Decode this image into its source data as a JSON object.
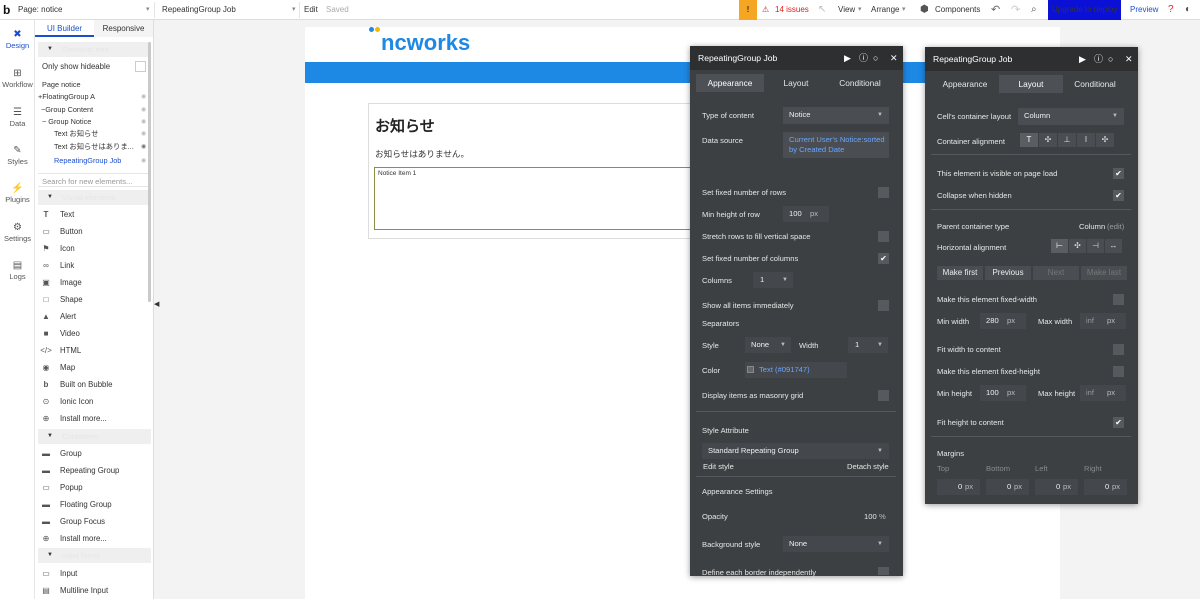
{
  "topbar": {
    "logo": "b",
    "page_label": "Page: notice",
    "element_selector": "RepeatingGroup Job",
    "edit": "Edit",
    "saved": "Saved",
    "issues": "14 issues",
    "view": "View",
    "arrange": "Arrange",
    "components": "Components",
    "deploy": "Upgrade to deploy",
    "preview": "Preview"
  },
  "rail": {
    "items": [
      {
        "label": "Design",
        "icon": "design-icon"
      },
      {
        "label": "Workflow",
        "icon": "workflow-icon"
      },
      {
        "label": "Data",
        "icon": "data-icon"
      },
      {
        "label": "Styles",
        "icon": "styles-icon"
      },
      {
        "label": "Plugins",
        "icon": "plugins-icon"
      },
      {
        "label": "Settings",
        "icon": "settings-icon"
      },
      {
        "label": "Logs",
        "icon": "logs-icon"
      }
    ]
  },
  "panel": {
    "tab_ui": "UI Builder",
    "tab_responsive": "Responsive",
    "elements_tree": "Elements tree",
    "only_hideable": "Only show hideable",
    "tree": [
      {
        "label": "Page notice"
      },
      {
        "label": "+FloatingGroup A"
      },
      {
        "label": "−Group Content"
      },
      {
        "label": "− Group Notice"
      },
      {
        "label": "Text お知らせ"
      },
      {
        "label": "Text お知らせはありま..."
      },
      {
        "label": "RepeatingGroup Job"
      }
    ],
    "search_placeholder": "Search for new elements...",
    "visual_elements": "Visual elements",
    "visual": [
      {
        "label": "Text",
        "icon": "text-icon"
      },
      {
        "label": "Button",
        "icon": "button-icon"
      },
      {
        "label": "Icon",
        "icon": "flag-icon"
      },
      {
        "label": "Link",
        "icon": "link-icon"
      },
      {
        "label": "Image",
        "icon": "image-icon"
      },
      {
        "label": "Shape",
        "icon": "shape-icon"
      },
      {
        "label": "Alert",
        "icon": "bell-icon"
      },
      {
        "label": "Video",
        "icon": "video-icon"
      },
      {
        "label": "HTML",
        "icon": "code-icon"
      },
      {
        "label": "Map",
        "icon": "map-pin-icon"
      },
      {
        "label": "Built on Bubble",
        "icon": "bubble-icon"
      },
      {
        "label": "Ionic Icon",
        "icon": "ionic-icon"
      },
      {
        "label": "Install more...",
        "icon": "plus-circle-icon"
      }
    ],
    "containers": "Containers",
    "container_items": [
      {
        "label": "Group",
        "icon": "folder-icon"
      },
      {
        "label": "Repeating Group",
        "icon": "folder-icon"
      },
      {
        "label": "Popup",
        "icon": "popup-icon"
      },
      {
        "label": "Floating Group",
        "icon": "folder-icon"
      },
      {
        "label": "Group Focus",
        "icon": "folder-icon"
      },
      {
        "label": "Install more...",
        "icon": "plus-circle-icon"
      }
    ],
    "input_forms": "Input forms",
    "input_items": [
      {
        "label": "Input",
        "icon": "input-icon"
      },
      {
        "label": "Multiline Input",
        "icon": "multiline-icon"
      }
    ]
  },
  "canvas": {
    "logo": "ncworks",
    "heading": "お知らせ",
    "message": "お知らせはありません。",
    "cell_label": "Notice Item 1"
  },
  "appearance": {
    "title": "RepeatingGroup Job",
    "tabs": [
      "Appearance",
      "Layout",
      "Conditional"
    ],
    "type_of_content_label": "Type of content",
    "type_of_content": "Notice",
    "data_source_label": "Data source",
    "data_source": "Current User's Notice:sorted by Created Date",
    "fixed_rows": "Set fixed number of rows",
    "min_height_row_label": "Min height of row",
    "min_height_row": "100",
    "unit_px": "px",
    "stretch_rows": "Stretch rows to fill vertical space",
    "fixed_columns": "Set fixed number of columns",
    "columns_label": "Columns",
    "columns": "1",
    "show_all": "Show all items immediately",
    "separators": "Separators",
    "style_label": "Style",
    "style_value": "None",
    "width_label": "Width",
    "width_value": "1",
    "color_label": "Color",
    "color_value": "Text (#091747)",
    "masonry": "Display items as masonry grid",
    "style_attr": "Style Attribute",
    "style_name": "Standard Repeating Group",
    "edit_style": "Edit style",
    "detach_style": "Detach style",
    "appearance_settings": "Appearance Settings",
    "opacity_label": "Opacity",
    "opacity_value": "100",
    "opacity_unit": "%",
    "background_label": "Background style",
    "background_value": "None",
    "border_label": "Define each border independently"
  },
  "layout": {
    "title": "RepeatingGroup Job",
    "tabs": [
      "Appearance",
      "Layout",
      "Conditional"
    ],
    "cell_layout_label": "Cell's container layout",
    "cell_layout": "Column",
    "container_alignment": "Container alignment",
    "visible_on_load": "This element is visible on page load",
    "collapse_hidden": "Collapse when hidden",
    "parent_type_label": "Parent container type",
    "parent_type": "Column",
    "parent_edit": "(edit)",
    "horizontal_alignment": "Horizontal alignment",
    "order_buttons": [
      "Make first",
      "Previous",
      "Next",
      "Make last"
    ],
    "fixed_width": "Make this element fixed-width",
    "min_width_label": "Min width",
    "min_width": "280",
    "max_width_label": "Max width",
    "max_width": "inf",
    "unit_px": "px",
    "fit_width": "Fit width to content",
    "fixed_height": "Make this element fixed-height",
    "min_height_label": "Min height",
    "min_height": "100",
    "max_height_label": "Max height",
    "max_height": "inf",
    "fit_height": "Fit height to content",
    "margins": "Margins",
    "margin_labels": [
      "Top",
      "Bottom",
      "Left",
      "Right"
    ],
    "margin_values": [
      "0",
      "0",
      "0",
      "0"
    ]
  },
  "colors": {
    "accent": "#1a4fd1",
    "band": "#1e88e5",
    "deploy": "#0a10d6",
    "issues": "#f5a623",
    "warning_text": "#e02020",
    "window_bg": "#3d4043"
  }
}
